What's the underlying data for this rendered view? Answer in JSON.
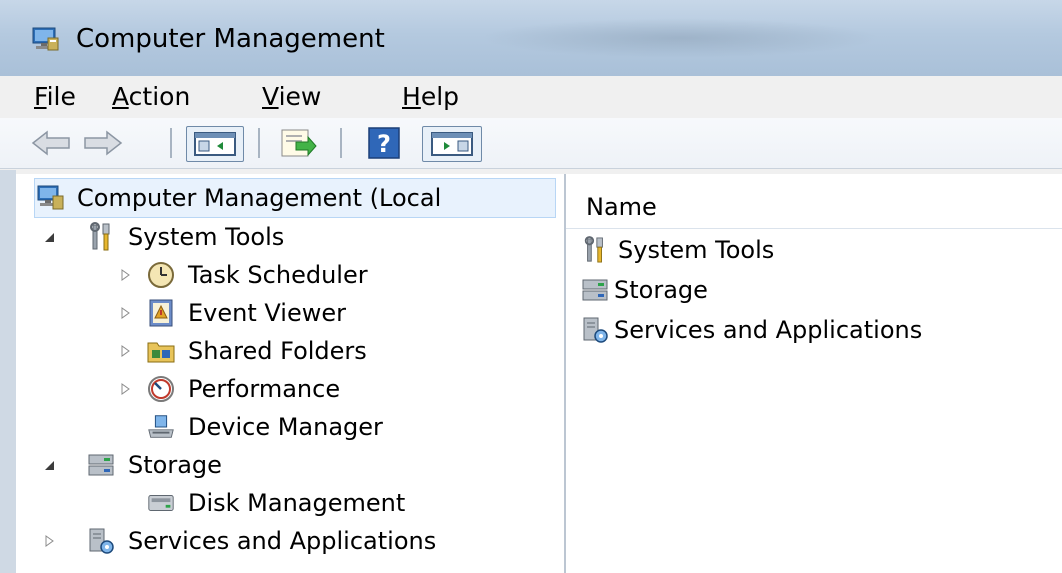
{
  "window": {
    "title": "Computer Management"
  },
  "menu": {
    "file": {
      "mnemonic": "F",
      "rest": "ile"
    },
    "action": {
      "mnemonic": "A",
      "rest": "ction"
    },
    "view": {
      "mnemonic": "V",
      "rest": "iew"
    },
    "help": {
      "mnemonic": "H",
      "rest": "elp"
    }
  },
  "tree": {
    "root": "Computer Management (Local",
    "system_tools": "System Tools",
    "task_scheduler": "Task Scheduler",
    "event_viewer": "Event Viewer",
    "shared_folders": "Shared Folders",
    "performance": "Performance",
    "device_manager": "Device Manager",
    "storage": "Storage",
    "disk_management": "Disk Management",
    "services_apps": "Services and Applications"
  },
  "list": {
    "column_name": "Name",
    "items": [
      "System Tools",
      "Storage",
      "Services and Applications"
    ]
  }
}
